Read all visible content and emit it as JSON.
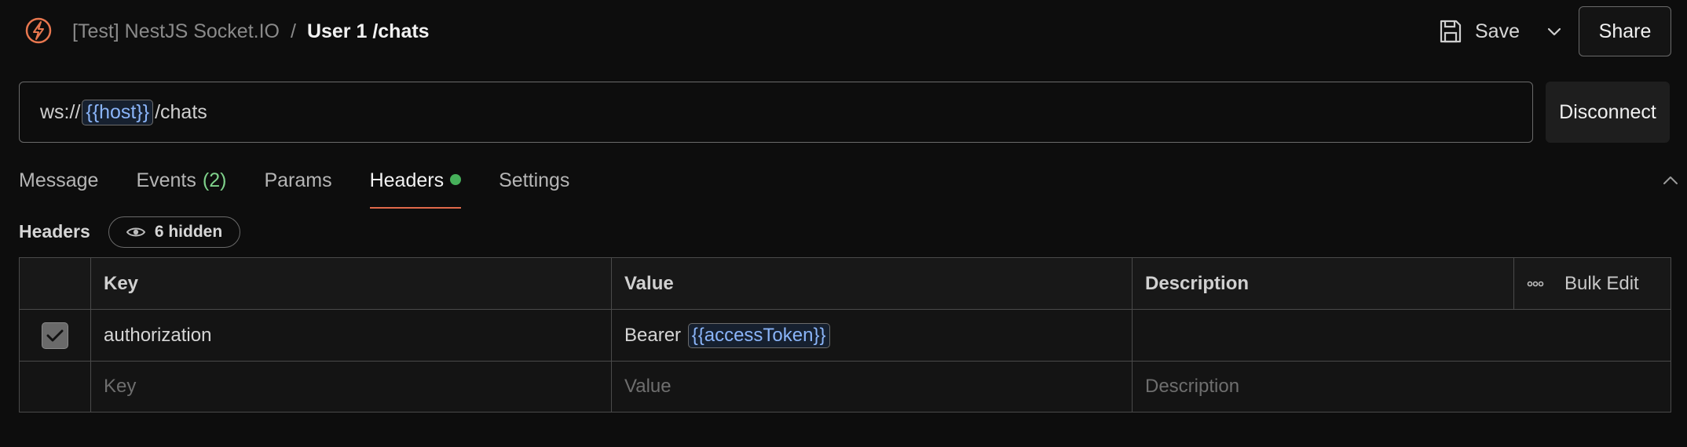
{
  "breadcrumb": {
    "collection": "[Test] NestJS Socket.IO",
    "separator": "/",
    "current": "User 1 /chats"
  },
  "toolbar": {
    "save_label": "Save",
    "share_label": "Share"
  },
  "url": {
    "prefix": "ws://",
    "variable": "{{host}}",
    "suffix": "/chats"
  },
  "disconnect_label": "Disconnect",
  "tabs": [
    {
      "label": "Message"
    },
    {
      "label": "Events",
      "count": "(2)"
    },
    {
      "label": "Params"
    },
    {
      "label": "Headers",
      "active": true
    },
    {
      "label": "Settings"
    }
  ],
  "headers_section": {
    "title": "Headers",
    "hidden_badge": "6 hidden"
  },
  "table": {
    "columns": {
      "key": "Key",
      "value": "Value",
      "description": "Description",
      "bulk_edit": "Bulk Edit"
    },
    "rows": [
      {
        "checked": true,
        "key": "authorization",
        "value_prefix": "Bearer ",
        "value_variable": "{{accessToken}}",
        "description": ""
      }
    ],
    "placeholders": {
      "key": "Key",
      "value": "Value",
      "description": "Description"
    }
  },
  "colors": {
    "accent": "#e0694a",
    "variable": "#8ab4f8",
    "active_dot": "#46b05a",
    "count": "#7fd18b"
  },
  "icons": {
    "logo": "postman-logo-icon",
    "save": "floppy-disk-icon",
    "dropdown": "chevron-down-icon",
    "collapse": "chevron-up-icon",
    "hidden": "eye-icon",
    "more": "more-dots-icon",
    "check": "checkmark-icon"
  }
}
